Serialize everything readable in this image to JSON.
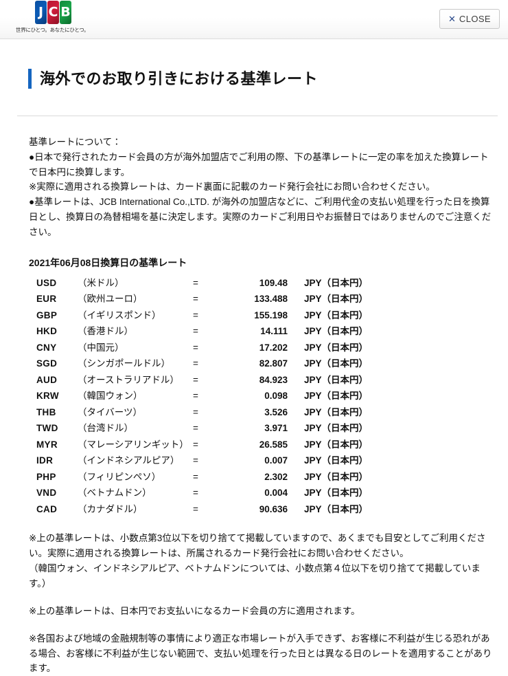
{
  "header": {
    "logo": {
      "tiles": [
        {
          "letter": "J",
          "color": "#0b5cb8",
          "name": "jcb-logo-tile-blue"
        },
        {
          "letter": "C",
          "color": "#cf1f3c",
          "name": "jcb-logo-tile-red"
        },
        {
          "letter": "B",
          "color": "#1aa449",
          "name": "jcb-logo-tile-green"
        }
      ],
      "tagline": "世界にひとつ。あなたにひとつ。"
    },
    "close_button": {
      "icon": "close-x-icon",
      "icon_glyph": "✕",
      "label": "CLOSE",
      "icon_color": "#2b4a8b"
    }
  },
  "page": {
    "title": "海外でのお取り引きにおける基準レート",
    "accent_color": "#1565c0"
  },
  "intro": {
    "lines": [
      "基準レートについて：",
      "●日本で発行されたカード会員の方が海外加盟店でご利用の際、下の基準レートに一定の率を加えた換算レートで日本円に換算します。",
      "※実際に適用される換算レートは、カード裏面に記載のカード発行会社にお問い合わせください。",
      "●基準レートは、JCB International Co.,LTD. が海外の加盟店などに、ご利用代金の支払い処理を行った日を換算日とし、換算日の為替相場を基に決定します。実際のカードご利用日やお振替日ではありませんのでご注意ください。"
    ]
  },
  "rates": {
    "heading": "2021年06月08日換算日の基準レート",
    "equals_symbol": "=",
    "unit_label": "JPY（日本円）",
    "rows": [
      {
        "code": "USD",
        "name": "（米ドル）",
        "value": "109.48"
      },
      {
        "code": "EUR",
        "name": "（欧州ユーロ）",
        "value": "133.488"
      },
      {
        "code": "GBP",
        "name": "（イギリスポンド）",
        "value": "155.198"
      },
      {
        "code": "HKD",
        "name": "（香港ドル）",
        "value": "14.111"
      },
      {
        "code": "CNY",
        "name": "（中国元）",
        "value": "17.202"
      },
      {
        "code": "SGD",
        "name": "（シンガポールドル）",
        "value": "82.807"
      },
      {
        "code": "AUD",
        "name": "（オーストラリアドル）",
        "value": "84.923"
      },
      {
        "code": "KRW",
        "name": "（韓国ウォン）",
        "value": "0.098"
      },
      {
        "code": "THB",
        "name": "（タイバーツ）",
        "value": "3.526"
      },
      {
        "code": "TWD",
        "name": "（台湾ドル）",
        "value": "3.971"
      },
      {
        "code": "MYR",
        "name": "（マレーシアリンギット）",
        "value": "26.585"
      },
      {
        "code": "IDR",
        "name": "（インドネシアルピア）",
        "value": "0.007"
      },
      {
        "code": "PHP",
        "name": "（フィリピンペソ）",
        "value": "2.302"
      },
      {
        "code": "VND",
        "name": "（ベトナムドン）",
        "value": "0.004"
      },
      {
        "code": "CAD",
        "name": "（カナダドル）",
        "value": "90.636"
      }
    ]
  },
  "notes": [
    "※上の基準レートは、小数点第3位以下を切り捨てて掲載していますので、あくまでも目安としてご利用ください。実際に適用される換算レートは、所属されるカード発行会社にお問い合わせください。",
    "（韓国ウォン、インドネシアルピア、ベトナムドンについては、小数点第４位以下を切り捨てて掲載しています。）",
    "※上の基準レートは、日本円でお支払いになるカード会員の方に適用されます。",
    "※各国および地域の金融規制等の事情により適正な市場レートが入手できず、お客様に不利益が生じる恐れがある場合、お客様に不利益が生じない範囲で、支払い処理を行った日とは異なる日のレートを適用することがあります。"
  ]
}
